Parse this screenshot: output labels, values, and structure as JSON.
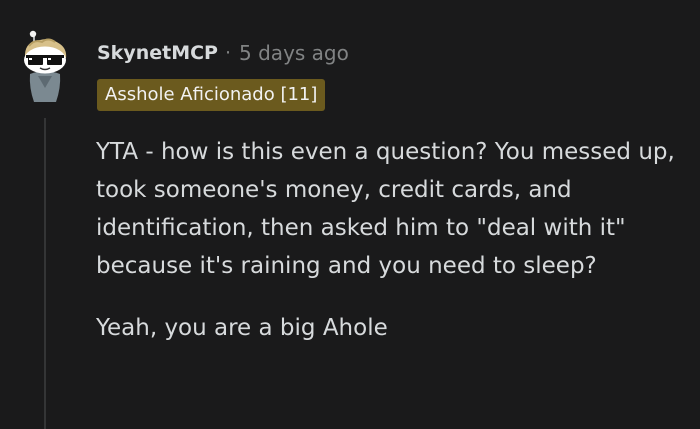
{
  "comment": {
    "username": "SkynetMCP",
    "separator": "·",
    "timestamp": "5 days ago",
    "flair": "Asshole Aficionado [11]",
    "paragraphs": [
      "YTA - how is this even a question? You messed up, took someone's money, credit cards, and identification, then asked him to \"deal with it\" because it's raining and you need to sleep?",
      "Yeah, you are a big Ahole"
    ]
  },
  "colors": {
    "background": "#1a1a1b",
    "text": "#d7dadc",
    "muted": "#818384",
    "flair_bg": "#6b5a1e",
    "thread_line": "#343536"
  }
}
